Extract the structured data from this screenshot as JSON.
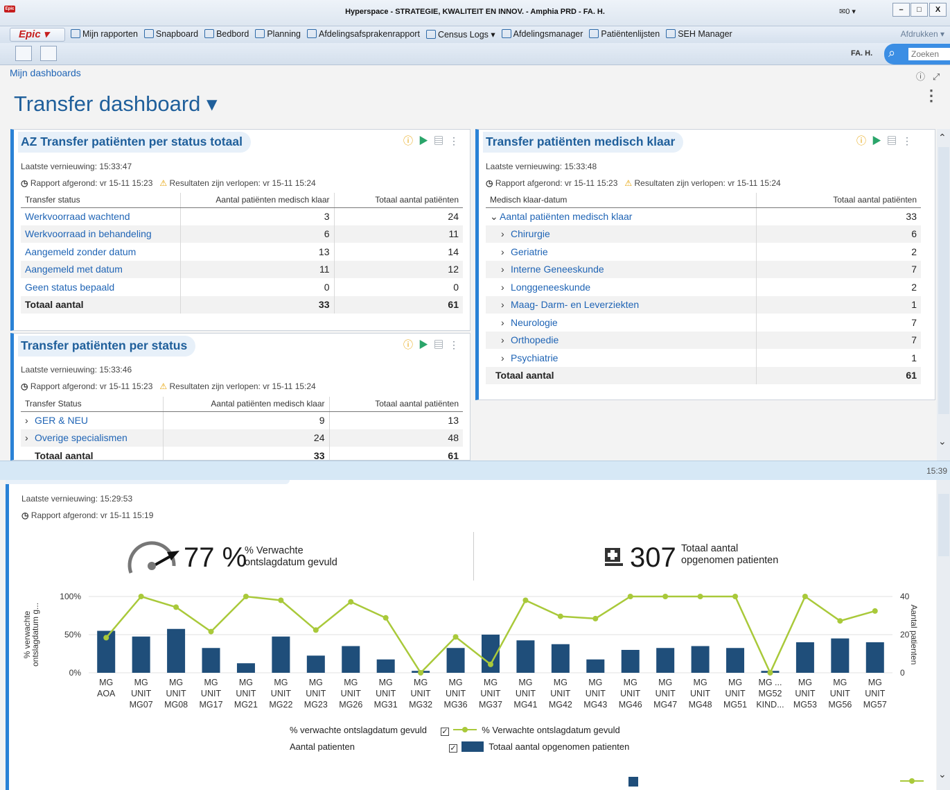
{
  "window": {
    "title": "Hyperspace - STRATEGIE, KWALITEIT EN INNOV. - Amphia PRD - FA. H.",
    "mail": "✉0 ▾",
    "logo_text": "Epic"
  },
  "menubar": {
    "epic_label": "Epic ▾",
    "items": [
      "Mijn rapporten",
      "Snapboard",
      "Bedbord",
      "Planning",
      "Afdelingsafsprakenrapport",
      "Census Logs ▾",
      "Afdelingsmanager",
      "Patiëntenlijsten",
      "SEH Manager"
    ],
    "print_label": "Afdrukken ▾"
  },
  "toolbar": {
    "user": "FA. H.",
    "search_placeholder": "Zoeken"
  },
  "breadcrumb": "Mijn dashboards",
  "page_title": "Transfer dashboard ▾",
  "card1": {
    "title": "AZ Transfer patiënten per status totaal",
    "last_refresh": "Laatste vernieuwing: 15:33:47",
    "report_done": "Rapport afgerond: vr 15-11 15:23",
    "expired": "Resultaten zijn verlopen: vr 15-11 15:24",
    "columns": [
      "Transfer status",
      "Aantal patiënten medisch klaar",
      "Totaal aantal patiënten"
    ],
    "rows": [
      [
        "Werkvoorraad wachtend",
        "3",
        "24"
      ],
      [
        "Werkvoorraad in behandeling",
        "6",
        "11"
      ],
      [
        "Aangemeld zonder datum",
        "13",
        "14"
      ],
      [
        "Aangemeld met datum",
        "11",
        "12"
      ],
      [
        "Geen status bepaald",
        "0",
        "0"
      ]
    ],
    "total": [
      "Totaal aantal",
      "33",
      "61"
    ]
  },
  "card2": {
    "title": "Transfer patiënten per status",
    "last_refresh": "Laatste vernieuwing: 15:33:46",
    "report_done": "Rapport afgerond: vr 15-11 15:23",
    "expired": "Resultaten zijn verlopen: vr 15-11 15:24",
    "columns": [
      "Transfer Status",
      "Aantal patiënten medisch klaar",
      "Totaal aantal patiënten"
    ],
    "rows": [
      [
        "GER & NEU",
        "9",
        "13"
      ],
      [
        "Overige specialismen",
        "24",
        "48"
      ]
    ],
    "total": [
      "Totaal aantal",
      "33",
      "61"
    ]
  },
  "card3": {
    "title": "Transfer patiënten medisch klaar",
    "last_refresh": "Laatste vernieuwing: 15:33:48",
    "report_done": "Rapport afgerond: vr 15-11 15:23",
    "expired": "Resultaten zijn verlopen: vr 15-11 15:24",
    "columns": [
      "Medisch klaar-datum",
      "Totaal aantal patiënten"
    ],
    "group": [
      "Aantal patiënten medisch klaar",
      "33"
    ],
    "rows": [
      [
        "Chirurgie",
        "6"
      ],
      [
        "Geriatrie",
        "2"
      ],
      [
        "Interne Geneeskunde",
        "7"
      ],
      [
        "Longgeneeskunde",
        "2"
      ],
      [
        "Maag- Darm- en Leverziekten",
        "1"
      ],
      [
        "Neurologie",
        "7"
      ],
      [
        "Orthopedie",
        "7"
      ],
      [
        "Psychiatrie",
        "1"
      ]
    ],
    "total": [
      "Totaal aantal",
      "61"
    ]
  },
  "statusbar": {
    "time": "15:39"
  },
  "bottom": {
    "last_refresh": "Laatste vernieuwing: 15:29:53",
    "report_done": "Rapport afgerond: vr 15-11 15:19",
    "kpi1_value": "77 %",
    "kpi1_label_1": "% Verwachte",
    "kpi1_label_2": "ontslagdatum gevuld",
    "kpi2_value": "307",
    "kpi2_label_1": "Totaal aantal",
    "kpi2_label_2": "opgenomen patienten",
    "legend": [
      {
        "group": "% verwachte ontslagdatum gevuld",
        "series": "% Verwachte ontslagdatum gevuld",
        "color": "#a9c93a"
      },
      {
        "group": "Aantal patienten",
        "series": "Totaal aantal opgenomen patienten",
        "color": "#1f4e7a"
      }
    ]
  },
  "chart_data": {
    "type": "bar",
    "ylabel": "% verwachte ontslagdatum g...",
    "y2label": "Aantal patienten",
    "ylim": [
      0,
      100
    ],
    "y2lim": [
      0,
      40
    ],
    "y_ticks": [
      "100%",
      "50%",
      "0%"
    ],
    "y2_ticks": [
      "40",
      "20",
      "0"
    ],
    "categories": [
      [
        "MG",
        "AOA"
      ],
      [
        "MG",
        "UNIT",
        "MG07"
      ],
      [
        "MG",
        "UNIT",
        "MG08"
      ],
      [
        "MG",
        "UNIT",
        "MG17"
      ],
      [
        "MG",
        "UNIT",
        "MG21"
      ],
      [
        "MG",
        "UNIT",
        "MG22"
      ],
      [
        "MG",
        "UNIT",
        "MG23"
      ],
      [
        "MG",
        "UNIT",
        "MG26"
      ],
      [
        "MG",
        "UNIT",
        "MG31"
      ],
      [
        "MG",
        "UNIT",
        "MG32"
      ],
      [
        "MG",
        "UNIT",
        "MG36"
      ],
      [
        "MG",
        "UNIT",
        "MG37"
      ],
      [
        "MG",
        "UNIT",
        "MG41"
      ],
      [
        "MG",
        "UNIT",
        "MG42"
      ],
      [
        "MG",
        "UNIT",
        "MG43"
      ],
      [
        "MG",
        "UNIT",
        "MG46"
      ],
      [
        "MG",
        "UNIT",
        "MG47"
      ],
      [
        "MG",
        "UNIT",
        "MG48"
      ],
      [
        "MG",
        "UNIT",
        "MG51"
      ],
      [
        "MG ...",
        "MG52",
        "KIND..."
      ],
      [
        "MG",
        "UNIT",
        "MG53"
      ],
      [
        "MG",
        "UNIT",
        "MG56"
      ],
      [
        "MG",
        "UNIT",
        "MG57"
      ]
    ],
    "series": [
      {
        "name": "Totaal aantal opgenomen patienten",
        "axis": "right",
        "kind": "bar",
        "color": "#1f4e7a",
        "values": [
          22,
          19,
          23,
          13,
          5,
          19,
          9,
          14,
          7,
          1,
          13,
          20,
          17,
          15,
          7,
          12,
          13,
          14,
          13,
          1,
          16,
          18,
          16
        ]
      },
      {
        "name": "% Verwachte ontslagdatum gevuld",
        "axis": "left",
        "kind": "line",
        "color": "#a9c93a",
        "values": [
          46,
          100,
          86,
          54,
          100,
          95,
          56,
          93,
          72,
          0,
          47,
          11,
          95,
          74,
          71,
          100,
          100,
          100,
          100,
          0,
          100,
          68,
          81
        ]
      }
    ]
  }
}
